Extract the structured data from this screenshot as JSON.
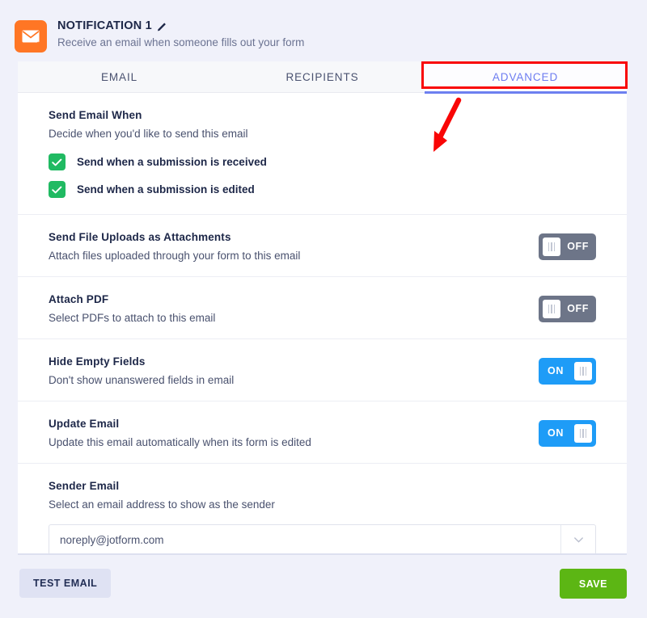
{
  "header": {
    "icon": "envelope-icon",
    "icon_bg": "#ff7624",
    "title": "NOTIFICATION 1",
    "edit_icon": "pencil-icon",
    "subtitle": "Receive an email when someone fills out your form"
  },
  "tabs": [
    {
      "label": "EMAIL",
      "active": false
    },
    {
      "label": "RECIPIENTS",
      "active": false
    },
    {
      "label": "ADVANCED",
      "active": true
    }
  ],
  "active_tab_color": "#6c7cf0",
  "sections": {
    "send_email_when": {
      "title": "Send Email When",
      "desc": "Decide when you'd like to send this email",
      "checkbox_color": "#20ba62",
      "options": [
        {
          "label": "Send when a submission is received",
          "checked": true
        },
        {
          "label": "Send when a submission is edited",
          "checked": true
        }
      ]
    },
    "rows": [
      {
        "title": "Send File Uploads as Attachments",
        "desc": "Attach files uploaded through your form to this email",
        "toggle": {
          "state": "off",
          "label": "OFF"
        }
      },
      {
        "title": "Attach PDF",
        "desc": "Select PDFs to attach to this email",
        "toggle": {
          "state": "off",
          "label": "OFF"
        }
      },
      {
        "title": "Hide Empty Fields",
        "desc": "Don't show unanswered fields in email",
        "toggle": {
          "state": "on",
          "label": "ON"
        }
      },
      {
        "title": "Update Email",
        "desc": "Update this email automatically when its form is edited",
        "toggle": {
          "state": "on",
          "label": "ON"
        }
      }
    ],
    "sender_email": {
      "title": "Sender Email",
      "desc": "Select an email address to show as the sender",
      "value": "noreply@jotform.com",
      "arrow_icon": "chevron-down-icon"
    }
  },
  "footer": {
    "test_email_label": "TEST EMAIL",
    "save_label": "SAVE",
    "save_color": "#5cb614"
  },
  "annotations": {
    "highlight_color": "#f90606",
    "box_target": "ADVANCED",
    "arrow": "down-left-arrow"
  },
  "toggle_colors": {
    "on": "#1e9cf7",
    "off": "#6d7588"
  }
}
